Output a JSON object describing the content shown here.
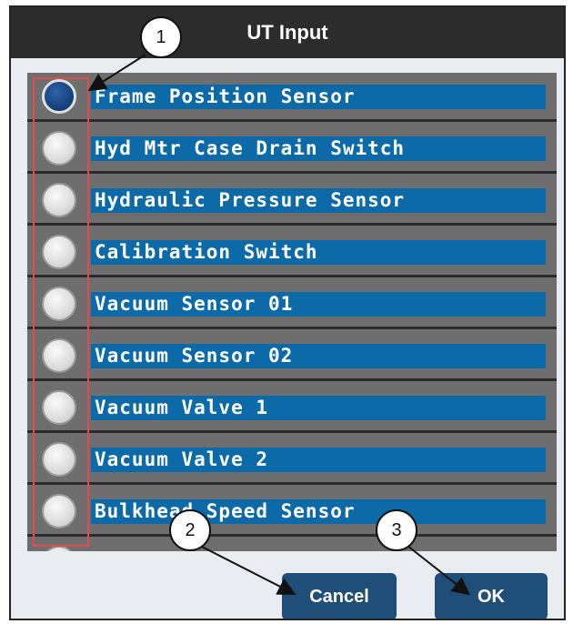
{
  "dialog": {
    "title": "UT Input",
    "items": [
      {
        "label": "Frame Position Sensor",
        "selected": true
      },
      {
        "label": "Hyd Mtr Case Drain Switch",
        "selected": false
      },
      {
        "label": "Hydraulic Pressure Sensor",
        "selected": false
      },
      {
        "label": "Calibration Switch",
        "selected": false
      },
      {
        "label": "Vacuum Sensor 01",
        "selected": false
      },
      {
        "label": "Vacuum Sensor 02",
        "selected": false
      },
      {
        "label": "Vacuum Valve 1",
        "selected": false
      },
      {
        "label": "Vacuum Valve 2",
        "selected": false
      },
      {
        "label": "Bulkhead Speed Sensor",
        "selected": false
      }
    ],
    "cancel_label": "Cancel",
    "ok_label": "OK"
  },
  "callouts": [
    "1",
    "2",
    "3"
  ],
  "colors": {
    "title_bar": "#2c2c2c",
    "list_background": "#6e6e6e",
    "label_background": "#0d6aa8",
    "selected_radio": "#123e78",
    "button": "#1f4f78",
    "highlight": "#e34a4a"
  }
}
